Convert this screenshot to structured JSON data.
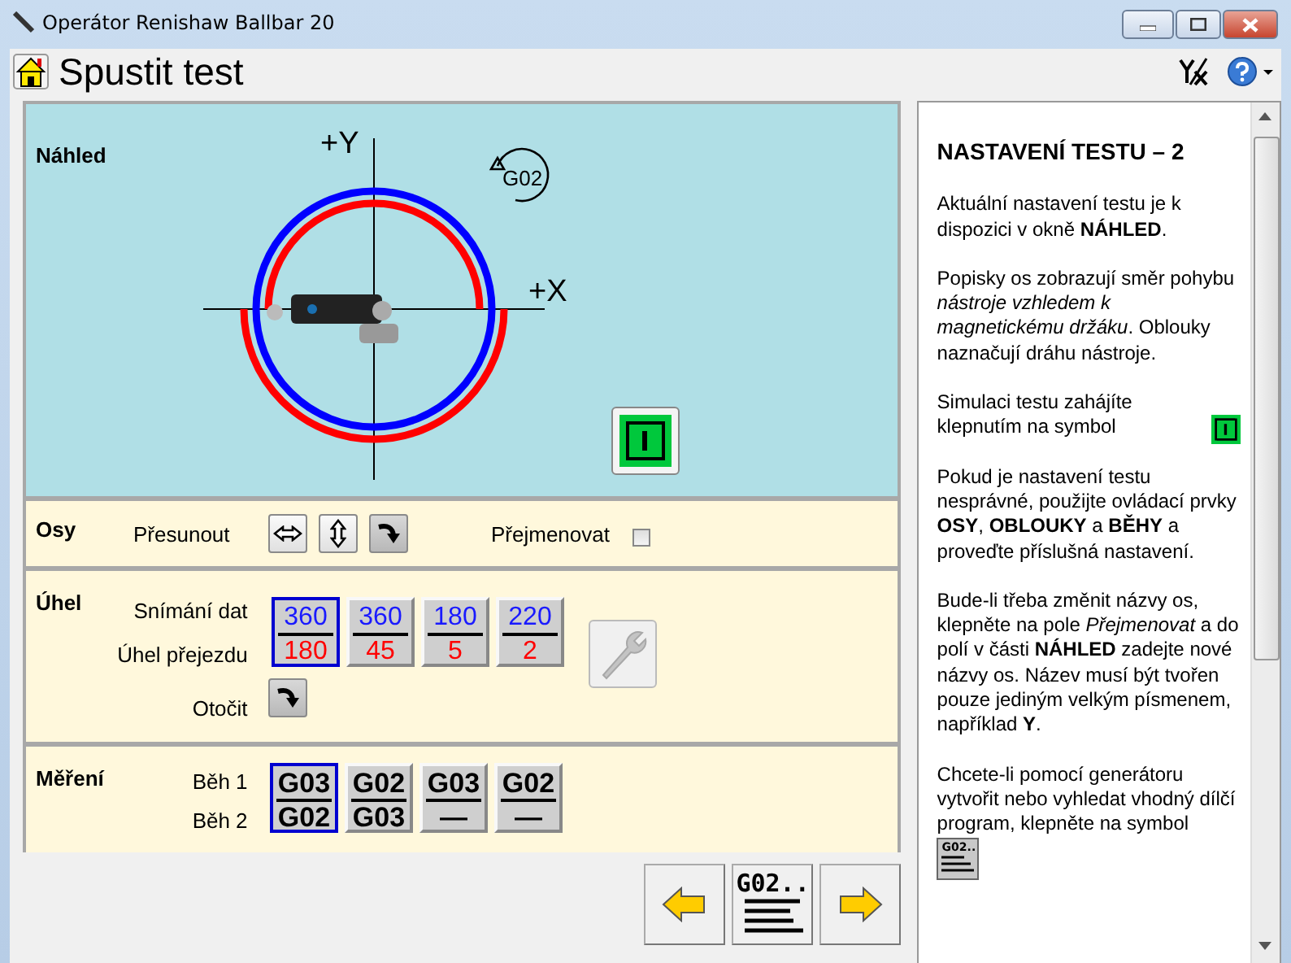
{
  "window": {
    "title": "Operátor Renishaw Ballbar 20"
  },
  "header": {
    "title": "Spustit test"
  },
  "preview": {
    "title": "Náhled",
    "y_label": "+Y",
    "x_label": "+X",
    "direction_label": "G02"
  },
  "axes": {
    "title": "Osy",
    "move_label": "Přesunout",
    "rename_label": "Přejmenovat",
    "rename_checked": false
  },
  "angle": {
    "title": "Úhel",
    "capture_label": "Snímání dat",
    "overrun_label": "Úhel přejezdu",
    "rotate_label": "Otočit",
    "settings_disabled": true,
    "options": [
      {
        "capture": "360",
        "overrun": "180",
        "selected": true
      },
      {
        "capture": "360",
        "overrun": "45",
        "selected": false
      },
      {
        "capture": "180",
        "overrun": "5",
        "selected": false
      },
      {
        "capture": "220",
        "overrun": "2",
        "selected": false
      }
    ]
  },
  "measurement": {
    "title": "Měření",
    "run1_label": "Běh 1",
    "run2_label": "Běh 2",
    "options": [
      {
        "run1": "G03",
        "run2": "G02",
        "selected": true
      },
      {
        "run1": "G02",
        "run2": "G03",
        "selected": false
      },
      {
        "run1": "G03",
        "run2": "—",
        "selected": false
      },
      {
        "run1": "G02",
        "run2": "—",
        "selected": false
      }
    ]
  },
  "nav": {
    "generator_label": "G02.."
  },
  "help": {
    "title": "NASTAVENÍ TESTU – 2",
    "paragraphs": [
      {
        "text": "Aktuální nastavení testu je k dispozici v okně **NÁHLED**."
      },
      {
        "text": "Popisky os zobrazují směr pohybu *nástroje vzhledem k magnetickému držáku*. Oblouky naznačují dráhu nástroje."
      },
      {
        "text": "Simulaci testu zahájíte klepnutím na symbol",
        "kind": "start"
      },
      {
        "text": "Pokud je nastavení testu nesprávné, použijte ovládací prvky **OSY**, **OBLOUKY** a **BĚHY** a proveďte příslušná nastavení."
      },
      {
        "text": "Bude-li třeba změnit názvy os, klepněte na pole *Přejmenovat* a do polí v části **NÁHLED** zadejte nové názvy os. Název musí být tvořen pouze jediným velkým písmenem, například **Y**."
      },
      {
        "text": "Chcete-li pomocí generátoru vytvořit nebo vyhledat vhodný dílčí program, klepněte na symbol",
        "kind": "generator",
        "icon_label": "G02.."
      }
    ]
  }
}
